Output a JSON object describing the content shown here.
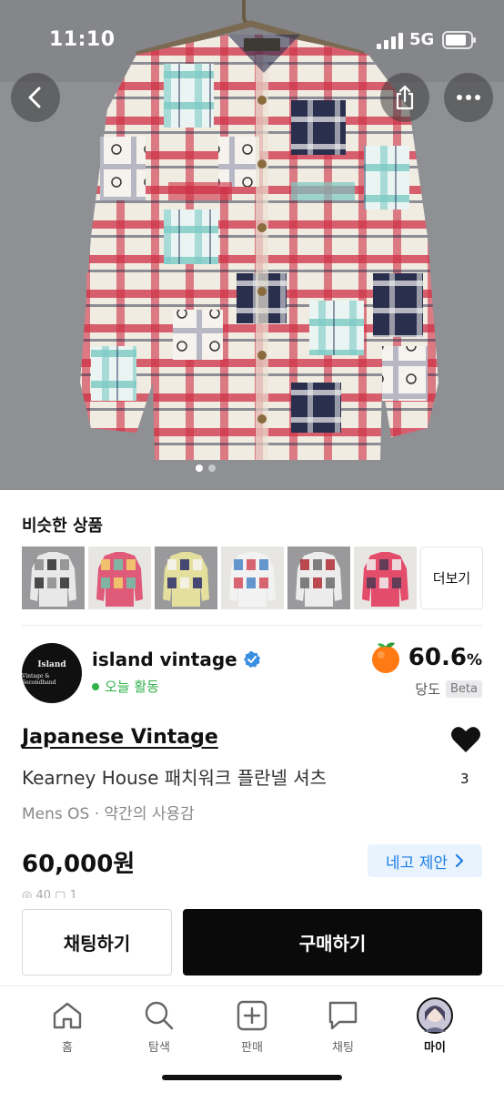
{
  "status_bar": {
    "time": "11:10",
    "network": "5G"
  },
  "hero": {
    "image_count": 2,
    "active_index": 0
  },
  "similar": {
    "title": "비슷한 상품",
    "more_label": "더보기",
    "thumbs": [
      {
        "name": "thumb-1",
        "colors": [
          "#2d2d2d",
          "#e8e8e8",
          "#8a8a8a"
        ]
      },
      {
        "name": "thumb-2",
        "colors": [
          "#6fc3a8",
          "#e05a7a",
          "#f2d26b"
        ]
      },
      {
        "name": "thumb-3",
        "colors": [
          "#2b2e6a",
          "#e4df9c",
          "#f4f4f0"
        ]
      },
      {
        "name": "thumb-4",
        "colors": [
          "#d24b5a",
          "#f2f2f2",
          "#4a86c6"
        ]
      },
      {
        "name": "thumb-5",
        "colors": [
          "#6b6b6b",
          "#ececec",
          "#b02b34"
        ]
      },
      {
        "name": "thumb-6",
        "colors": [
          "#4e3a55",
          "#e44c6b",
          "#f0f0f0"
        ]
      }
    ]
  },
  "seller": {
    "avatar_line1": "Island",
    "avatar_line2": "Vintage & Secondhand",
    "name": "island vintage",
    "status": "오늘 활동",
    "score": "60.6",
    "score_unit": "%",
    "score_label": "당도",
    "beta": "Beta"
  },
  "product": {
    "shop": "Japanese Vintage",
    "name": "Kearney House 패치워크 플란넬 셔츠",
    "meta": "Mens OS · 약간의 사용감",
    "price": "60,000원",
    "offer_label": "네고 제안",
    "likes": "3",
    "stats": "◎ 40  ▢ 1"
  },
  "actions": {
    "chat": "채팅하기",
    "buy": "구매하기"
  },
  "tabs": [
    {
      "label": "홈"
    },
    {
      "label": "탐색"
    },
    {
      "label": "판매"
    },
    {
      "label": "채팅"
    },
    {
      "label": "마이"
    }
  ],
  "colors": {
    "accent_blue": "#1e7ee4",
    "online_green": "#2fb24a",
    "buy_black": "#0a0a0a",
    "offer_bg": "#e8f3fd"
  }
}
